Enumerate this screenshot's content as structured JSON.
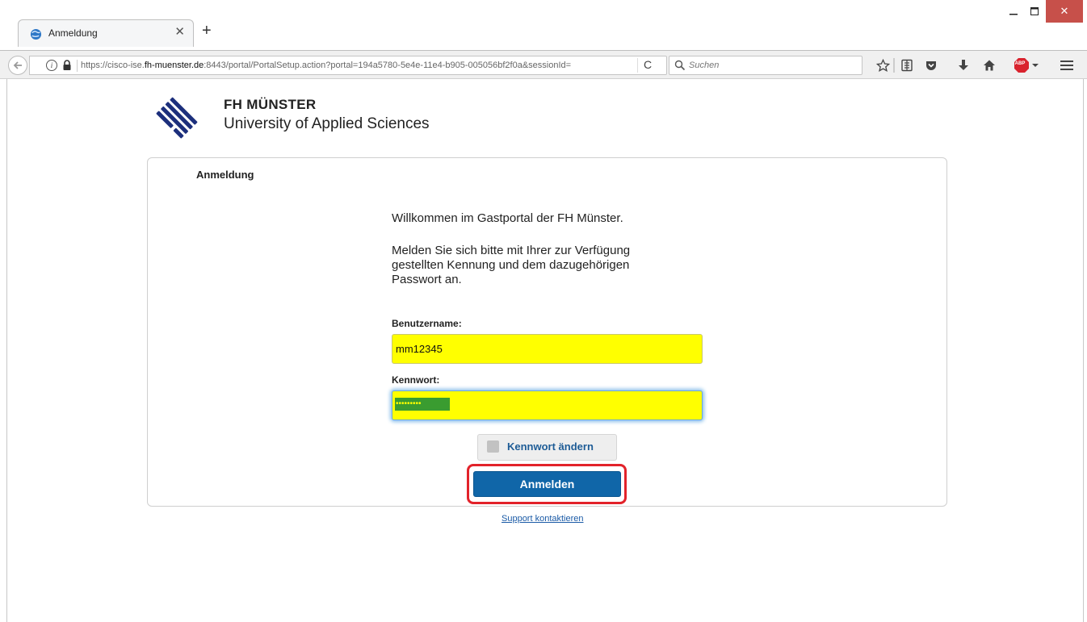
{
  "browser": {
    "tab_title": "Anmeldung",
    "tab_close_glyph": "✕",
    "new_tab_glyph": "+",
    "url_host_prefix": "https://cisco-ise.",
    "url_host_domain": "fh-muenster.de",
    "url_rest": ":8443/portal/PortalSetup.action?portal=194a5780-5e4e-11e4-b905-005056bf2f0a&sessionId=",
    "info_glyph": "i",
    "reload_glyph": "C",
    "search_placeholder": "Suchen",
    "adblock_label": "ABP",
    "window_close_glyph": "✕",
    "icons": [
      "back-arrow-icon",
      "info-icon",
      "lock-icon",
      "reload-icon",
      "search-icon",
      "bookmark-star-icon",
      "reading-list-icon",
      "pocket-icon",
      "download-icon",
      "home-icon",
      "adblock-icon",
      "menu-icon"
    ]
  },
  "page": {
    "brand_name": "FH MÜNSTER",
    "brand_subtitle": "University of Applied Sciences",
    "heading": "Anmeldung",
    "welcome": "Willkommen im Gastportal der FH Münster.",
    "instructions": "Melden Sie sich bitte mit Ihrer zur Verfügung gestellten Kennung und dem dazugehörigen Passwort an.",
    "username_label": "Benutzername:",
    "username_value": "mm12345",
    "password_label": "Kennwort:",
    "password_mask": "•••••••••",
    "change_password_label": "Kennwort ändern",
    "login_button": "Anmelden",
    "support_link": "Support kontaktieren"
  },
  "colors": {
    "login_button": "#1066a8",
    "highlight": "#e2222a",
    "autofill_field": "#ffff00",
    "link": "#1a5aa6",
    "window_close": "#c7504a"
  }
}
